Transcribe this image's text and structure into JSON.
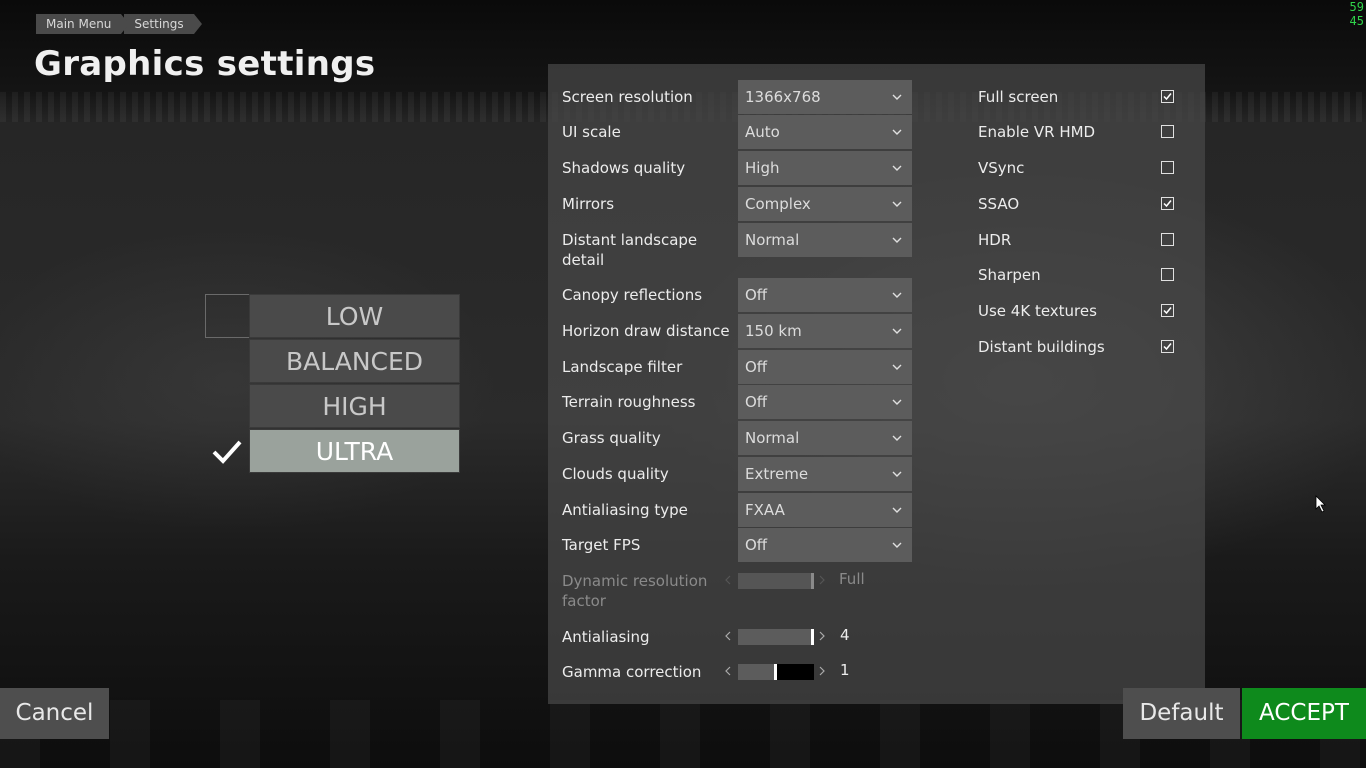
{
  "breadcrumb": [
    "Main Menu",
    "Settings"
  ],
  "title": "Graphics settings",
  "fps_counter": "5945",
  "presets": [
    {
      "label": "LOW",
      "selected": false
    },
    {
      "label": "BALANCED",
      "selected": false
    },
    {
      "label": "HIGH",
      "selected": false
    },
    {
      "label": "ULTRA",
      "selected": true
    }
  ],
  "dropdowns": [
    {
      "label": "Screen resolution",
      "value": "1366x768"
    },
    {
      "label": "UI scale",
      "value": "Auto"
    },
    {
      "label": "Shadows quality",
      "value": "High"
    },
    {
      "label": "Mirrors",
      "value": "Complex"
    },
    {
      "label": "Distant landscape detail",
      "value": "Normal"
    },
    {
      "label": "Canopy reflections",
      "value": "Off"
    },
    {
      "label": "Horizon draw distance",
      "value": "150 km"
    },
    {
      "label": "Landscape filter",
      "value": "Off"
    },
    {
      "label": "Terrain roughness",
      "value": "Off"
    },
    {
      "label": "Grass quality",
      "value": "Normal"
    },
    {
      "label": "Clouds quality",
      "value": "Extreme"
    },
    {
      "label": "Antialiasing type",
      "value": "FXAA"
    },
    {
      "label": "Target FPS",
      "value": "Off"
    }
  ],
  "sliders": [
    {
      "label": "Dynamic resolution factor",
      "value": "Full",
      "fraction": 0.98,
      "disabled": true
    },
    {
      "label": "Antialiasing",
      "value": "4",
      "fraction": 0.98,
      "disabled": false
    },
    {
      "label": "Gamma correction",
      "value": "1",
      "fraction": 0.49,
      "disabled": false
    }
  ],
  "checkboxes": [
    {
      "label": "Full screen",
      "checked": true
    },
    {
      "label": "Enable VR HMD",
      "checked": false
    },
    {
      "label": "VSync",
      "checked": false
    },
    {
      "label": "SSAO",
      "checked": true
    },
    {
      "label": "HDR",
      "checked": false
    },
    {
      "label": "Sharpen",
      "checked": false
    },
    {
      "label": "Use 4K textures",
      "checked": true
    },
    {
      "label": "Distant buildings",
      "checked": true
    }
  ],
  "buttons": {
    "cancel": "Cancel",
    "default": "Default",
    "accept": "ACCEPT"
  },
  "colors": {
    "accept": "#0e8a1c",
    "fps": "#2fd34a",
    "preset_selected": "#9aa29c"
  }
}
